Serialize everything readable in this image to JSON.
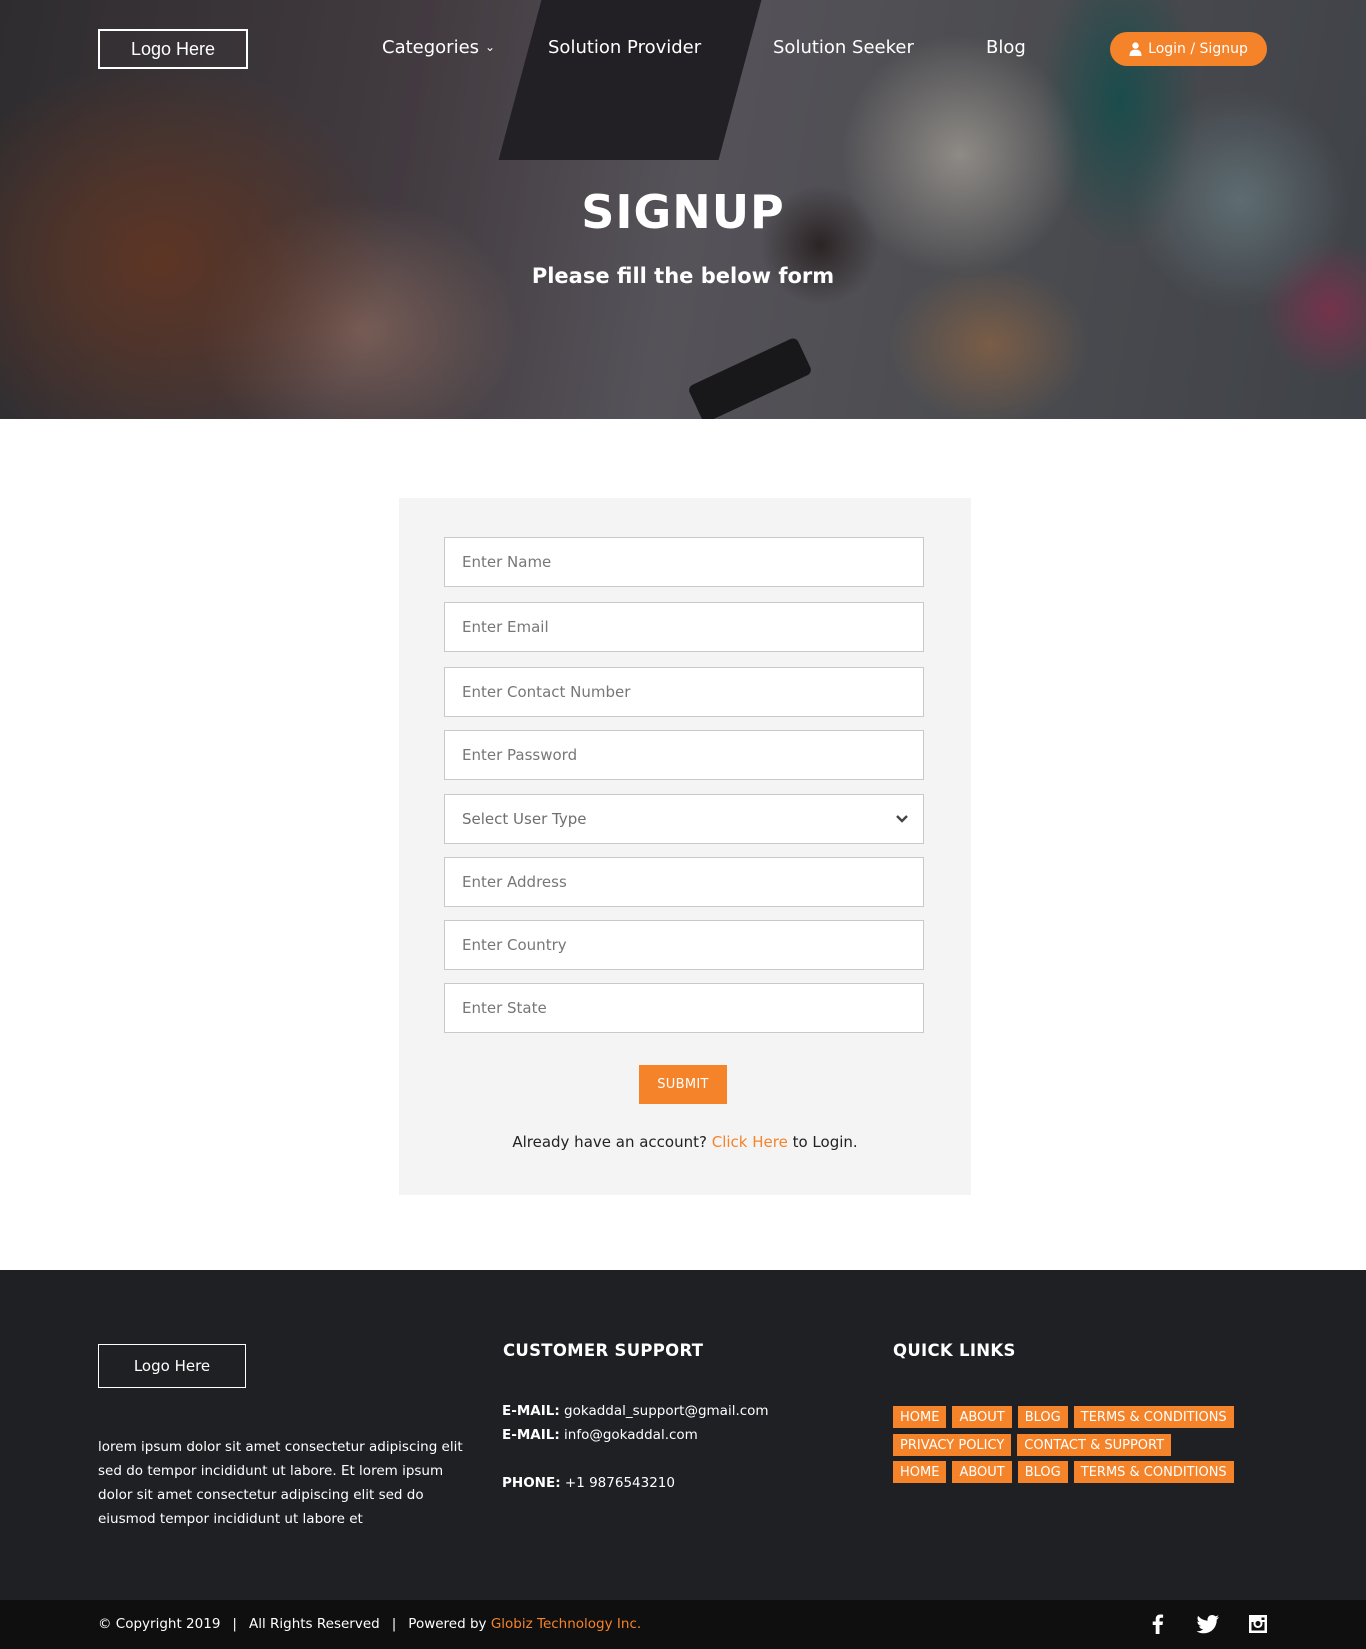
{
  "nav": {
    "logo": "Logo Here",
    "links": [
      "Categories",
      "Solution Provider",
      "Solution Seeker",
      "Blog"
    ],
    "login_label": "Login / Signup"
  },
  "hero": {
    "title": "SIGNUP",
    "subtitle": "Please fill the below form"
  },
  "form": {
    "name_placeholder": "Enter Name",
    "email_placeholder": "Enter Email",
    "contact_placeholder": "Enter Contact Number",
    "password_placeholder": "Enter Password",
    "user_type_selected": "Select User Type",
    "address_placeholder": "Enter Address",
    "country_placeholder": "Enter Country",
    "state_placeholder": "Enter State",
    "submit_label": "SUBMIT",
    "login_prefix": "Already have an account?",
    "login_link": "Click Here",
    "login_suffix": "to Login."
  },
  "footer": {
    "logo": "Logo Here",
    "about": "lorem ipsum dolor sit amet consectetur adipiscing elit sed do tempor incididunt ut labore.  Et lorem ipsum dolor sit amet consectetur adipiscing elit sed do eiusmod tempor incididunt ut labore et",
    "support_heading": "CUSTOMER SUPPORT",
    "email1_label": "E-MAIL:",
    "email1": "gokaddal_support@gmail.com",
    "email2_label": "E-MAIL:",
    "email2": "info@gokaddal.com",
    "phone_label": "PHONE:",
    "phone": "+1 9876543210",
    "links_heading": "QUICK LINKS",
    "quick_links_row1": [
      "HOME",
      "ABOUT",
      "BLOG",
      "TERMS & CONDITIONS"
    ],
    "quick_links_row2": [
      "PRIVACY POLICY",
      "CONTACT & SUPPORT"
    ],
    "quick_links_row3": [
      "HOME",
      "ABOUT",
      "BLOG",
      "TERMS & CONDITIONS"
    ]
  },
  "bottom": {
    "copyright": "© Copyright 2019",
    "rights": "All Rights Reserved",
    "powered_prefix": "Powered by",
    "powered_brand": "Globiz Technology Inc.",
    "social_icons": [
      "facebook-icon",
      "twitter-icon",
      "instagram-icon"
    ]
  },
  "colors": {
    "accent": "#f5832a",
    "footer_bg": "#1f2024",
    "bottom_bar_bg": "#0f0f10",
    "form_bg": "#f4f4f4"
  }
}
